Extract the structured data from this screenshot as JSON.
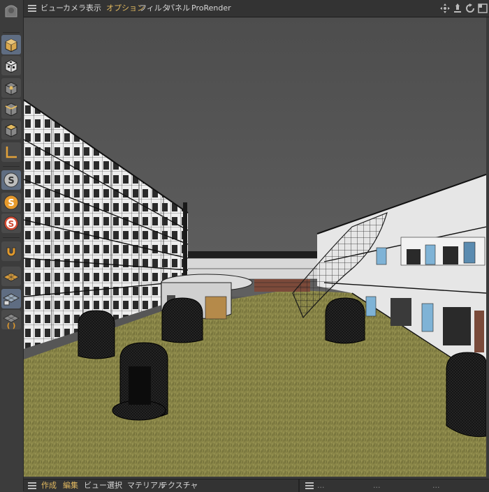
{
  "menubar": {
    "items": [
      {
        "label": "ビュー"
      },
      {
        "label": "カメラ"
      },
      {
        "label": "表示"
      },
      {
        "label": "オプション",
        "highlight": true
      },
      {
        "label": "フィルタ"
      },
      {
        "label": "パネル"
      },
      {
        "label": "ProRender"
      }
    ],
    "nav_icons": [
      "move-icon",
      "zoom-icon",
      "rotate-icon",
      "maximize-icon"
    ]
  },
  "toolbar": {
    "tools": [
      {
        "icon": "cube-object-mode-icon",
        "active": true
      },
      {
        "icon": "checker-cube-icon",
        "active": false
      },
      {
        "icon": "point-mode-icon",
        "active": false
      },
      {
        "icon": "edge-mode-icon",
        "active": false
      },
      {
        "icon": "polygon-mode-icon",
        "active": false
      },
      {
        "icon": "axis-icon",
        "active": false
      },
      {
        "icon": "snap-s-icon",
        "active": true
      },
      {
        "icon": "snap-s-orange-icon",
        "active": false
      },
      {
        "icon": "snap-s-red-icon",
        "active": false
      },
      {
        "icon": "magnet-icon",
        "active": false
      },
      {
        "icon": "workplane-icon",
        "active": false
      },
      {
        "icon": "lock-workplane-icon",
        "active": true
      },
      {
        "icon": "grid-snap-icon",
        "active": false
      }
    ]
  },
  "bottombar": {
    "items": [
      {
        "label": "作成",
        "highlight": true
      },
      {
        "label": "編集",
        "highlight": true
      },
      {
        "label": "ビュー"
      },
      {
        "label": "選択"
      },
      {
        "label": "マテリアル"
      },
      {
        "label": "テクスチャ"
      }
    ],
    "right_items": [
      {
        "label": "..."
      },
      {
        "label": "..."
      },
      {
        "label": "..."
      }
    ]
  },
  "colors": {
    "accent": "#e2b960",
    "active_tool": "#5f6d82",
    "viewport_sky": "#565656",
    "grass": "#8d8a4a"
  }
}
